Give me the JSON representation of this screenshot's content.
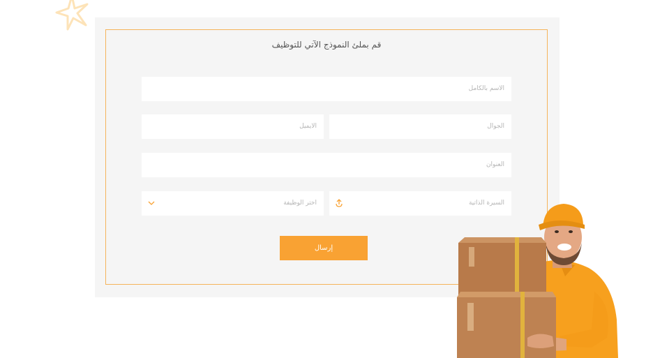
{
  "form": {
    "title": "قم بملئ النموذج الآتي للتوظيف",
    "full_name": {
      "placeholder": "الاسم بالكامل",
      "value": ""
    },
    "mobile": {
      "placeholder": "الجوال",
      "value": ""
    },
    "email": {
      "placeholder": "الايميل",
      "value": ""
    },
    "address": {
      "placeholder": "العنوان",
      "value": ""
    },
    "cv": {
      "placeholder": "السيرة الذاتية",
      "icon": "upload-icon"
    },
    "job": {
      "placeholder": "اختر الوظيفة",
      "icon": "chevron-down-icon"
    },
    "submit_label": "إرسال"
  },
  "colors": {
    "accent": "#f9a233",
    "frame_border": "#f5b45a",
    "panel_bg": "#f5f5f5",
    "field_bg": "#ffffff",
    "placeholder": "#b5b5b5",
    "decor_star": "#fde3b8"
  }
}
